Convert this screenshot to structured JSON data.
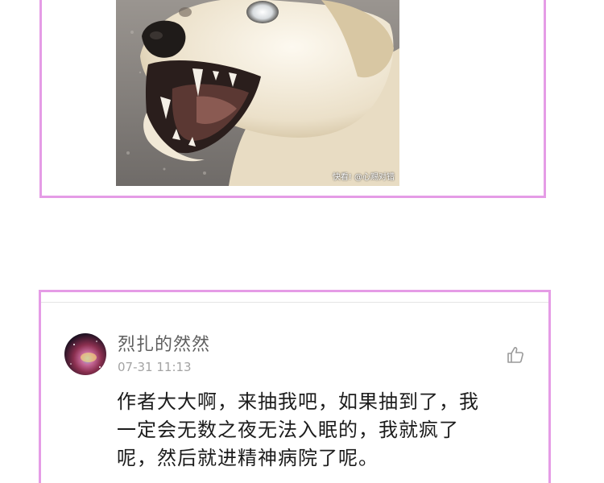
{
  "post": {
    "image": {
      "alt_icon": "snarling-dog-meme",
      "watermark": "快看! @心赐对错"
    }
  },
  "comment": {
    "username": "烈扎的然然",
    "timestamp": "07-31 11:13",
    "text": "作者大大啊，来抽我吧，如果抽到了，我\n一定会无数之夜无法入眠的，我就疯了\n呢，然后就进精神病院了呢。",
    "like_icon": "thumbs-up-icon",
    "avatar_icon": "galaxy-avatar"
  },
  "colors": {
    "frame_border": "#e59ce6",
    "username": "#5f5f5f",
    "timestamp": "#a3a3a3",
    "text": "#1c1c1c"
  }
}
